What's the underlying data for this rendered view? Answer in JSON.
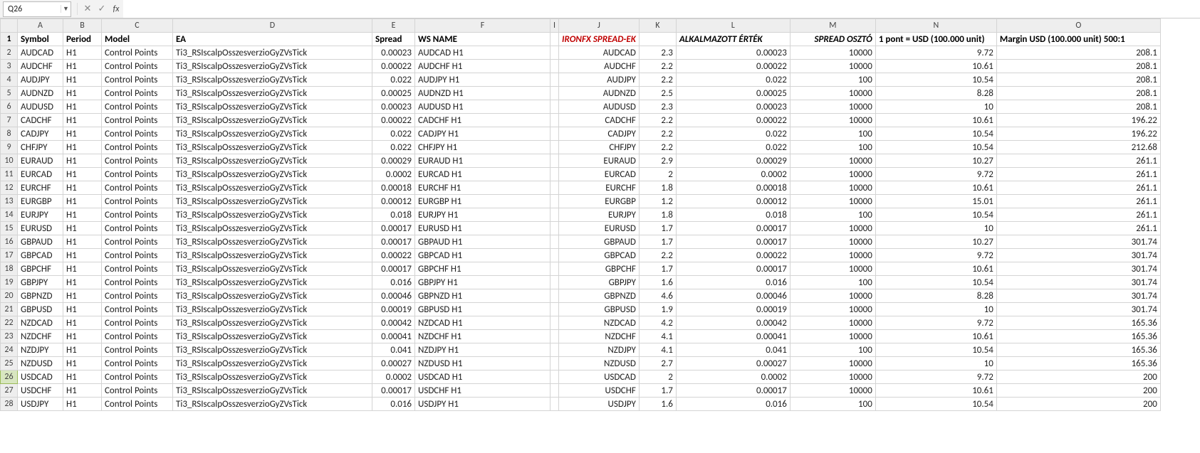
{
  "nameBox": {
    "value": "Q26"
  },
  "formulaBar": {
    "cancel_glyph": "✕",
    "enter_glyph": "✓",
    "fx_label": "fx",
    "value": ""
  },
  "columnLetters": [
    "A",
    "B",
    "C",
    "D",
    "E",
    "F",
    "I",
    "J",
    "K",
    "L",
    "M",
    "N",
    "O"
  ],
  "header": {
    "A": "Symbol",
    "B": "Period",
    "C": "Model",
    "D": "EA",
    "E": "Spread",
    "F": "WS NAME",
    "I": "",
    "J": "IRONFX SPREAD-EK",
    "K": "",
    "L": "ALKALMAZOTT ÉRTÉK",
    "M": "SPREAD OSZTÓ",
    "N": "1 pont = USD (100.000 unit)",
    "O": "Margin USD (100.000 unit) 500:1"
  },
  "default": {
    "B": "H1",
    "C": "Control Points",
    "D": "Ti3_RSIscalpOsszesverzioGyZVsTick"
  },
  "rows": [
    {
      "n": 2,
      "A": "AUDCAD",
      "E": "0.00023",
      "F": "AUDCAD  H1",
      "J": "AUDCAD",
      "K": "2.3",
      "L": "0.00023",
      "M": "10000",
      "N": "9.72",
      "O": "208.1"
    },
    {
      "n": 3,
      "A": "AUDCHF",
      "E": "0.00022",
      "F": "AUDCHF  H1",
      "J": "AUDCHF",
      "K": "2.2",
      "L": "0.00022",
      "M": "10000",
      "N": "10.61",
      "O": "208.1"
    },
    {
      "n": 4,
      "A": "AUDJPY",
      "E": "0.022",
      "F": "AUDJPY  H1",
      "J": "AUDJPY",
      "K": "2.2",
      "L": "0.022",
      "M": "100",
      "N": "10.54",
      "O": "208.1"
    },
    {
      "n": 5,
      "A": "AUDNZD",
      "E": "0.00025",
      "F": "AUDNZD  H1",
      "J": "AUDNZD",
      "K": "2.5",
      "L": "0.00025",
      "M": "10000",
      "N": "8.28",
      "O": "208.1"
    },
    {
      "n": 6,
      "A": "AUDUSD",
      "E": "0.00023",
      "F": "AUDUSD  H1",
      "J": "AUDUSD",
      "K": "2.3",
      "L": "0.00023",
      "M": "10000",
      "N": "10",
      "O": "208.1"
    },
    {
      "n": 7,
      "A": "CADCHF",
      "E": "0.00022",
      "F": "CADCHF  H1",
      "J": "CADCHF",
      "K": "2.2",
      "L": "0.00022",
      "M": "10000",
      "N": "10.61",
      "O": "196.22"
    },
    {
      "n": 8,
      "A": "CADJPY",
      "E": "0.022",
      "F": "CADJPY  H1",
      "J": "CADJPY",
      "K": "2.2",
      "L": "0.022",
      "M": "100",
      "N": "10.54",
      "O": "196.22"
    },
    {
      "n": 9,
      "A": "CHFJPY",
      "E": "0.022",
      "F": "CHFJPY  H1",
      "J": "CHFJPY",
      "K": "2.2",
      "L": "0.022",
      "M": "100",
      "N": "10.54",
      "O": "212.68"
    },
    {
      "n": 10,
      "A": "EURAUD",
      "E": "0.00029",
      "F": "EURAUD  H1",
      "J": "EURAUD",
      "K": "2.9",
      "L": "0.00029",
      "M": "10000",
      "N": "10.27",
      "O": "261.1"
    },
    {
      "n": 11,
      "A": "EURCAD",
      "E": "0.0002",
      "F": "EURCAD  H1",
      "J": "EURCAD",
      "K": "2",
      "L": "0.0002",
      "M": "10000",
      "N": "9.72",
      "O": "261.1"
    },
    {
      "n": 12,
      "A": "EURCHF",
      "E": "0.00018",
      "F": "EURCHF  H1",
      "J": "EURCHF",
      "K": "1.8",
      "L": "0.00018",
      "M": "10000",
      "N": "10.61",
      "O": "261.1"
    },
    {
      "n": 13,
      "A": "EURGBP",
      "E": "0.00012",
      "F": "EURGBP  H1",
      "J": "EURGBP",
      "K": "1.2",
      "L": "0.00012",
      "M": "10000",
      "N": "15.01",
      "O": "261.1"
    },
    {
      "n": 14,
      "A": "EURJPY",
      "E": "0.018",
      "F": "EURJPY  H1",
      "J": "EURJPY",
      "K": "1.8",
      "L": "0.018",
      "M": "100",
      "N": "10.54",
      "O": "261.1"
    },
    {
      "n": 15,
      "A": "EURUSD",
      "E": "0.00017",
      "F": "EURUSD  H1",
      "J": "EURUSD",
      "K": "1.7",
      "L": "0.00017",
      "M": "10000",
      "N": "10",
      "O": "261.1"
    },
    {
      "n": 16,
      "A": "GBPAUD",
      "E": "0.00017",
      "F": "GBPAUD  H1",
      "J": "GBPAUD",
      "K": "1.7",
      "L": "0.00017",
      "M": "10000",
      "N": "10.27",
      "O": "301.74"
    },
    {
      "n": 17,
      "A": "GBPCAD",
      "E": "0.00022",
      "F": "GBPCAD  H1",
      "J": "GBPCAD",
      "K": "2.2",
      "L": "0.00022",
      "M": "10000",
      "N": "9.72",
      "O": "301.74"
    },
    {
      "n": 18,
      "A": "GBPCHF",
      "E": "0.00017",
      "F": "GBPCHF  H1",
      "J": "GBPCHF",
      "K": "1.7",
      "L": "0.00017",
      "M": "10000",
      "N": "10.61",
      "O": "301.74"
    },
    {
      "n": 19,
      "A": "GBPJPY",
      "E": "0.016",
      "F": "GBPJPY  H1",
      "J": "GBPJPY",
      "K": "1.6",
      "L": "0.016",
      "M": "100",
      "N": "10.54",
      "O": "301.74"
    },
    {
      "n": 20,
      "A": "GBPNZD",
      "E": "0.00046",
      "F": "GBPNZD  H1",
      "J": "GBPNZD",
      "K": "4.6",
      "L": "0.00046",
      "M": "10000",
      "N": "8.28",
      "O": "301.74"
    },
    {
      "n": 21,
      "A": "GBPUSD",
      "E": "0.00019",
      "F": "GBPUSD  H1",
      "J": "GBPUSD",
      "K": "1.9",
      "L": "0.00019",
      "M": "10000",
      "N": "10",
      "O": "301.74"
    },
    {
      "n": 22,
      "A": "NZDCAD",
      "E": "0.00042",
      "F": "NZDCAD  H1",
      "J": "NZDCAD",
      "K": "4.2",
      "L": "0.00042",
      "M": "10000",
      "N": "9.72",
      "O": "165.36"
    },
    {
      "n": 23,
      "A": "NZDCHF",
      "E": "0.00041",
      "F": "NZDCHF  H1",
      "J": "NZDCHF",
      "K": "4.1",
      "L": "0.00041",
      "M": "10000",
      "N": "10.61",
      "O": "165.36"
    },
    {
      "n": 24,
      "A": "NZDJPY",
      "E": "0.041",
      "F": "NZDJPY  H1",
      "J": "NZDJPY",
      "K": "4.1",
      "L": "0.041",
      "M": "100",
      "N": "10.54",
      "O": "165.36"
    },
    {
      "n": 25,
      "A": "NZDUSD",
      "E": "0.00027",
      "F": "NZDUSD  H1",
      "J": "NZDUSD",
      "K": "2.7",
      "L": "0.00027",
      "M": "10000",
      "N": "10",
      "O": "165.36"
    },
    {
      "n": 26,
      "A": "USDCAD",
      "E": "0.0002",
      "F": "USDCAD  H1",
      "J": "USDCAD",
      "K": "2",
      "L": "0.0002",
      "M": "10000",
      "N": "9.72",
      "O": "200"
    },
    {
      "n": 27,
      "A": "USDCHF",
      "E": "0.00017",
      "F": "USDCHF  H1",
      "J": "USDCHF",
      "K": "1.7",
      "L": "0.00017",
      "M": "10000",
      "N": "10.61",
      "O": "200"
    },
    {
      "n": 28,
      "A": "USDJPY",
      "E": "0.016",
      "F": "USDJPY  H1",
      "J": "USDJPY",
      "K": "1.6",
      "L": "0.016",
      "M": "100",
      "N": "10.54",
      "O": "200"
    }
  ],
  "activeRow": 26
}
